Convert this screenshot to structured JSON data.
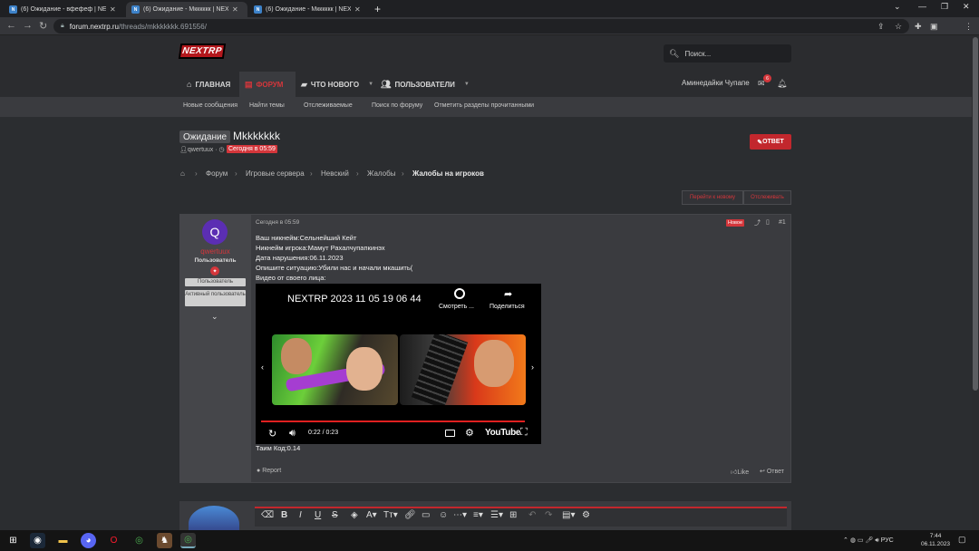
{
  "browser": {
    "tabs": [
      {
        "title": "(6) Ожидание - вфефеф | NEXT"
      },
      {
        "title": "(6) Ожидание - Мкккккк | NEX"
      },
      {
        "title": "(6) Ожидание - Мкккккк | NEX"
      }
    ],
    "url_host": "forum.nextrp.ru",
    "url_path": "/threads/mkkkkkkk.691556/"
  },
  "site": {
    "logo": "NEXTRP",
    "search_placeholder": "Поиск...",
    "nav": {
      "home": "ГЛАВНАЯ",
      "forums": "ФОРУМ",
      "whats_new": "ЧТО НОВОГО",
      "members": "ПОЛЬЗОВАТЕЛИ"
    },
    "username": "Аминедайки Чупапе",
    "inbox_count": "6",
    "subnav": [
      "Новые сообщения",
      "Найти темы",
      "Отслеживаемые",
      "Поиск по форуму",
      "Отметить разделы прочитанными"
    ]
  },
  "thread": {
    "prefix": "Ожидание",
    "title": "Мkkkkkkk",
    "author": "qwertuux",
    "date": "Сегодня в 05:59",
    "reply_button": "ОТВЕТ",
    "breadcrumbs": [
      "Форум",
      "Игровые сервера",
      "Невский",
      "Жалобы",
      "Жалобы на игроков"
    ],
    "goto_new": "Перейти к новому",
    "watch": "Отслеживать"
  },
  "post": {
    "user": {
      "initial": "Q",
      "name": "qwertuux",
      "title": "Пользователь",
      "banners": [
        "Пользователь",
        "Активный пользователь"
      ]
    },
    "date": "Сегодня в 05:59",
    "new_tag": "Новое",
    "number": "#1",
    "lines": [
      "Ваш никнейм:Сельнейший Кейт",
      "Никнейм игрока:Мамут Рахалчупапкинэх",
      "Дата нарушения:06.11.2023",
      "Опишите ситуацию:Убили нас и начали мкашить(",
      "Видео от своего лица:"
    ],
    "video": {
      "title": "NEXTRP 2023 11 05 19 06 44",
      "watch_later": "Смотреть ...",
      "share": "Поделиться",
      "time": "0:22 / 0:23",
      "brand": "YouTube",
      "progress": 0.96
    },
    "footer_line": "Таим Код:0.14",
    "report": "Report",
    "like": "Like",
    "reply": "Ответ"
  },
  "taskbar": {
    "lang": "РУС",
    "time": "7:44",
    "date": "06.11.2023"
  }
}
